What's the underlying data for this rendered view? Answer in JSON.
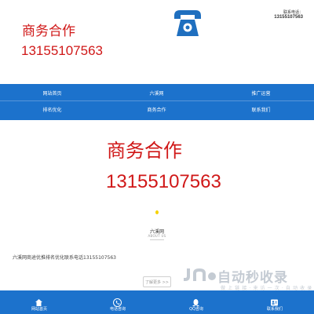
{
  "header": {
    "promo_title": "商务合作",
    "promo_phone": "13155107563",
    "contact_label": "联系电话：",
    "contact_phone": "13155107563",
    "logo_icon": "telephone-icon"
  },
  "nav": {
    "items": [
      {
        "label": "网站首页"
      },
      {
        "label": "六溪网"
      },
      {
        "label": "推广运营"
      },
      {
        "label": "排名优化"
      },
      {
        "label": "商务合作"
      },
      {
        "label": "联系我们"
      }
    ]
  },
  "main": {
    "promo_title": "商务合作",
    "promo_phone": "13155107563",
    "about_title": "六溪网",
    "about_subtitle": "ABOUT US",
    "about_text": "六溪网商途优推排名优化联系电话13155107563",
    "more_label": "了解更多 >>"
  },
  "watermark": {
    "text": "自动秒收录",
    "subtext": "做 上 链 接 · 来 访 一 次 · 自 动 收 录"
  },
  "footer": {
    "items": [
      {
        "label": "网站首页",
        "icon": "home-icon"
      },
      {
        "label": "电话咨询",
        "icon": "phone-icon"
      },
      {
        "label": "QQ咨询",
        "icon": "qq-icon"
      },
      {
        "label": "联系我们",
        "icon": "contact-card-icon"
      }
    ]
  },
  "colors": {
    "brand_blue": "#1c72cc",
    "promo_red": "#d01818",
    "accent_yellow": "#f6d200"
  }
}
